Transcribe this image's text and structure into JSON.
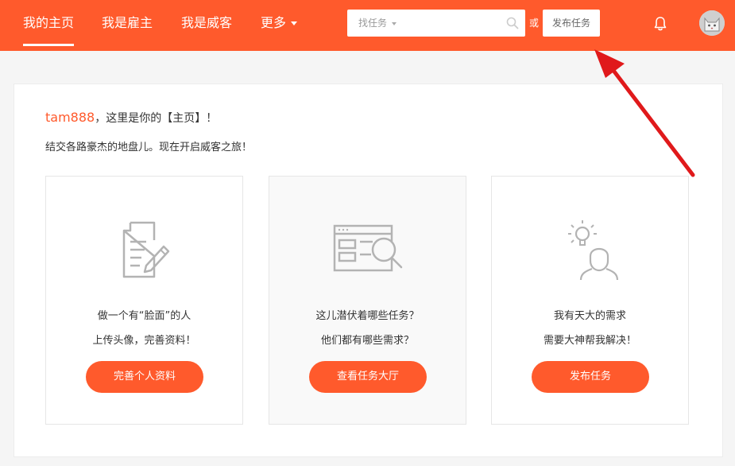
{
  "nav": {
    "items": [
      {
        "label": "我的主页",
        "active": true
      },
      {
        "label": "我是雇主",
        "active": false
      },
      {
        "label": "我是威客",
        "active": false
      },
      {
        "label": "更多",
        "active": false
      }
    ]
  },
  "search": {
    "type_label": "找任务",
    "or_text": "或",
    "publish_label": "发布任务"
  },
  "main": {
    "username": "tam888",
    "greeting_rest": "，这里是你的【主页】！",
    "subline": "结交各路豪杰的地盘儿。现在开启威客之旅！",
    "cards": [
      {
        "icon": "document-edit-icon",
        "line1": "做一个有“脸面”的人",
        "line2": "上传头像，完善资料！",
        "button": "完善个人资料"
      },
      {
        "icon": "browser-search-icon",
        "line1": "这儿潜伏着哪些任务？",
        "line2": "他们都有哪些需求？",
        "button": "查看任务大厅"
      },
      {
        "icon": "idea-person-icon",
        "line1": "我有天大的需求",
        "line2": "需要大神帮我解决！",
        "button": "发布任务"
      }
    ]
  },
  "colors": {
    "brand": "#ff5a2c",
    "annotation_arrow": "#e0191b"
  }
}
